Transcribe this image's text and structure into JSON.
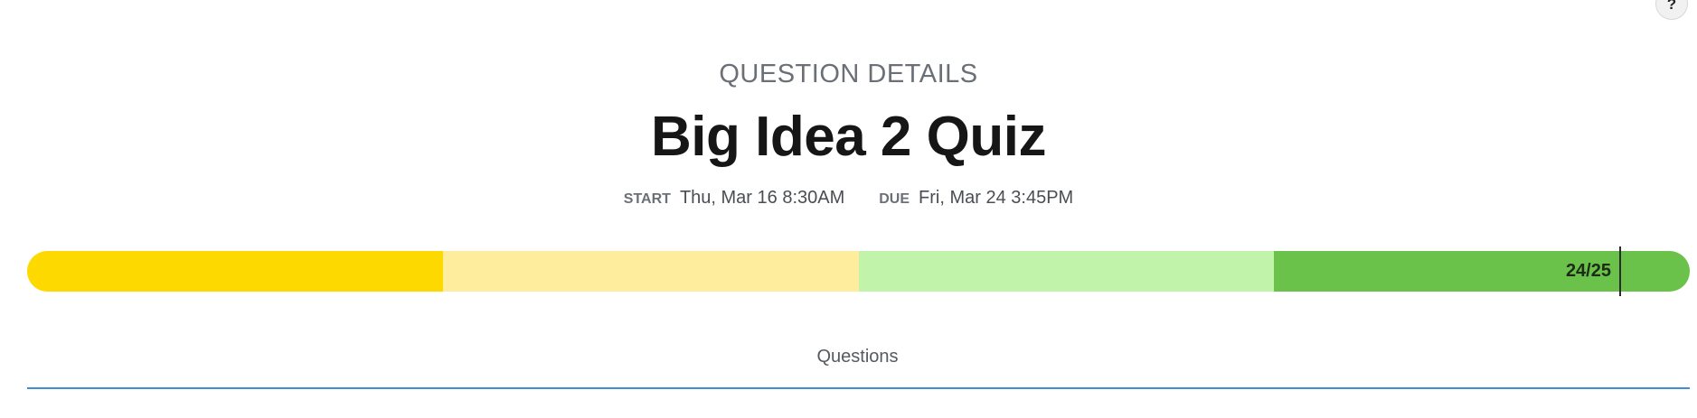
{
  "help": {
    "label": "?"
  },
  "header": {
    "eyebrow": "QUESTION DETAILS",
    "title": "Big Idea 2 Quiz"
  },
  "dates": {
    "start_label": "START",
    "start_value": "Thu, Mar 16 8:30AM",
    "due_label": "DUE",
    "due_value": "Fri, Mar 24 3:45PM"
  },
  "progress": {
    "score_text": "24/25",
    "score": 24,
    "total": 25,
    "segment_colors": [
      "#fdd900",
      "#feed9d",
      "#c1f4aa",
      "#6bc24a"
    ]
  },
  "tabs": {
    "questions_label": "Questions",
    "active_color": "#3d8fd6"
  }
}
